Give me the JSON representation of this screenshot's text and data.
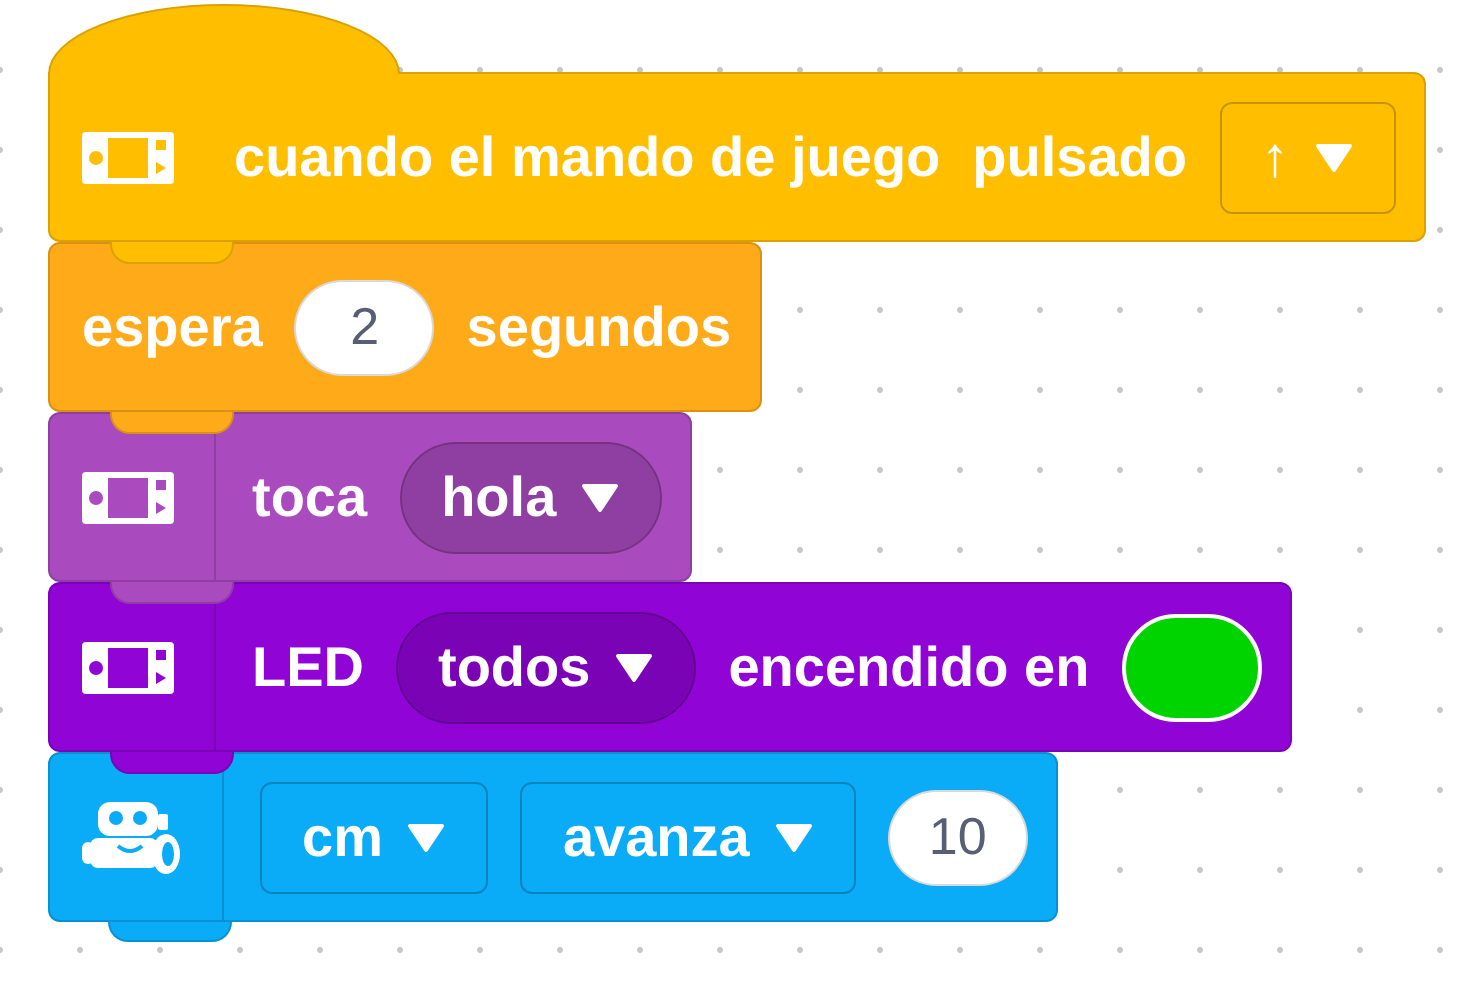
{
  "blocks": [
    {
      "kind": "hat",
      "color": "#ffbf00",
      "parts": [
        {
          "kind": "text",
          "text": "cuando el mando de juego"
        },
        {
          "kind": "text",
          "text": "pulsado"
        },
        {
          "kind": "dropdown",
          "outlined": true,
          "text": "↑"
        }
      ]
    },
    {
      "kind": "wait",
      "color": "#ffab19",
      "parts": [
        {
          "kind": "text",
          "text": "espera"
        },
        {
          "kind": "number",
          "text": "2"
        },
        {
          "kind": "text",
          "text": "segundos"
        }
      ]
    },
    {
      "kind": "sound",
      "color": "#a94bbe",
      "parts": [
        {
          "kind": "text",
          "text": "toca"
        },
        {
          "kind": "dropdown",
          "outlined": false,
          "text": "hola"
        }
      ]
    },
    {
      "kind": "led",
      "color": "#9104d6",
      "parts": [
        {
          "kind": "text",
          "text": "LED"
        },
        {
          "kind": "dropdown",
          "outlined": false,
          "text": "todos"
        },
        {
          "kind": "text",
          "text": "encendido en"
        },
        {
          "kind": "color",
          "color": "#00d400"
        }
      ]
    },
    {
      "kind": "motion",
      "color": "#0aabf7",
      "parts": [
        {
          "kind": "dropdown",
          "outlined": true,
          "text": "cm"
        },
        {
          "kind": "dropdown",
          "outlined": true,
          "text": "avanza"
        },
        {
          "kind": "number",
          "text": "10"
        }
      ]
    }
  ]
}
